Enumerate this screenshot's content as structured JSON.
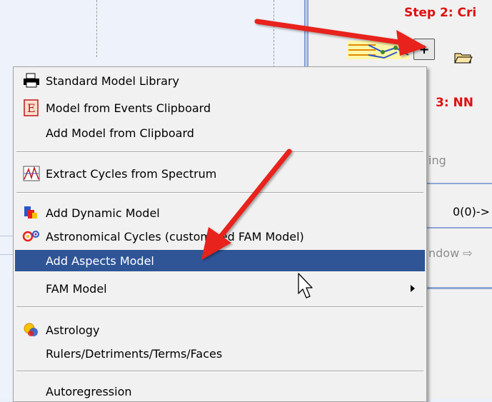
{
  "background": {
    "step2_label": "Step 2: Cri",
    "step3_label": "3: NN",
    "ing_text": "ing",
    "value_text": "0(0)->",
    "window_text": "ndow ⇨"
  },
  "menu": {
    "items": [
      {
        "label": "Standard Model Library",
        "icon": "printer-library-icon"
      },
      {
        "label": "Model from Events Clipboard",
        "icon": "event-clipboard-icon"
      },
      {
        "label": "Add Model from Clipboard",
        "icon": ""
      },
      {
        "label": "Extract Cycles from Spectrum",
        "icon": "spectrum-chart-icon"
      },
      {
        "label": "Add Dynamic Model",
        "icon": "dynamic-model-icon"
      },
      {
        "label": "Astronomical Cycles (customized FAM Model)",
        "icon": "astronomical-cycles-icon"
      },
      {
        "label": "Add Aspects Model",
        "icon": ""
      },
      {
        "label": "FAM Model",
        "icon": "",
        "has_submenu": true
      },
      {
        "label": "Astrology",
        "icon": "astrology-icon"
      },
      {
        "label": "Rulers/Detriments/Terms/Faces",
        "icon": ""
      },
      {
        "label": "Autoregression",
        "icon": ""
      }
    ],
    "selected_index": 6
  },
  "colors": {
    "selection": "#2f5597",
    "annotation_arrow": "#e8201a",
    "step_label": "#e01010"
  }
}
